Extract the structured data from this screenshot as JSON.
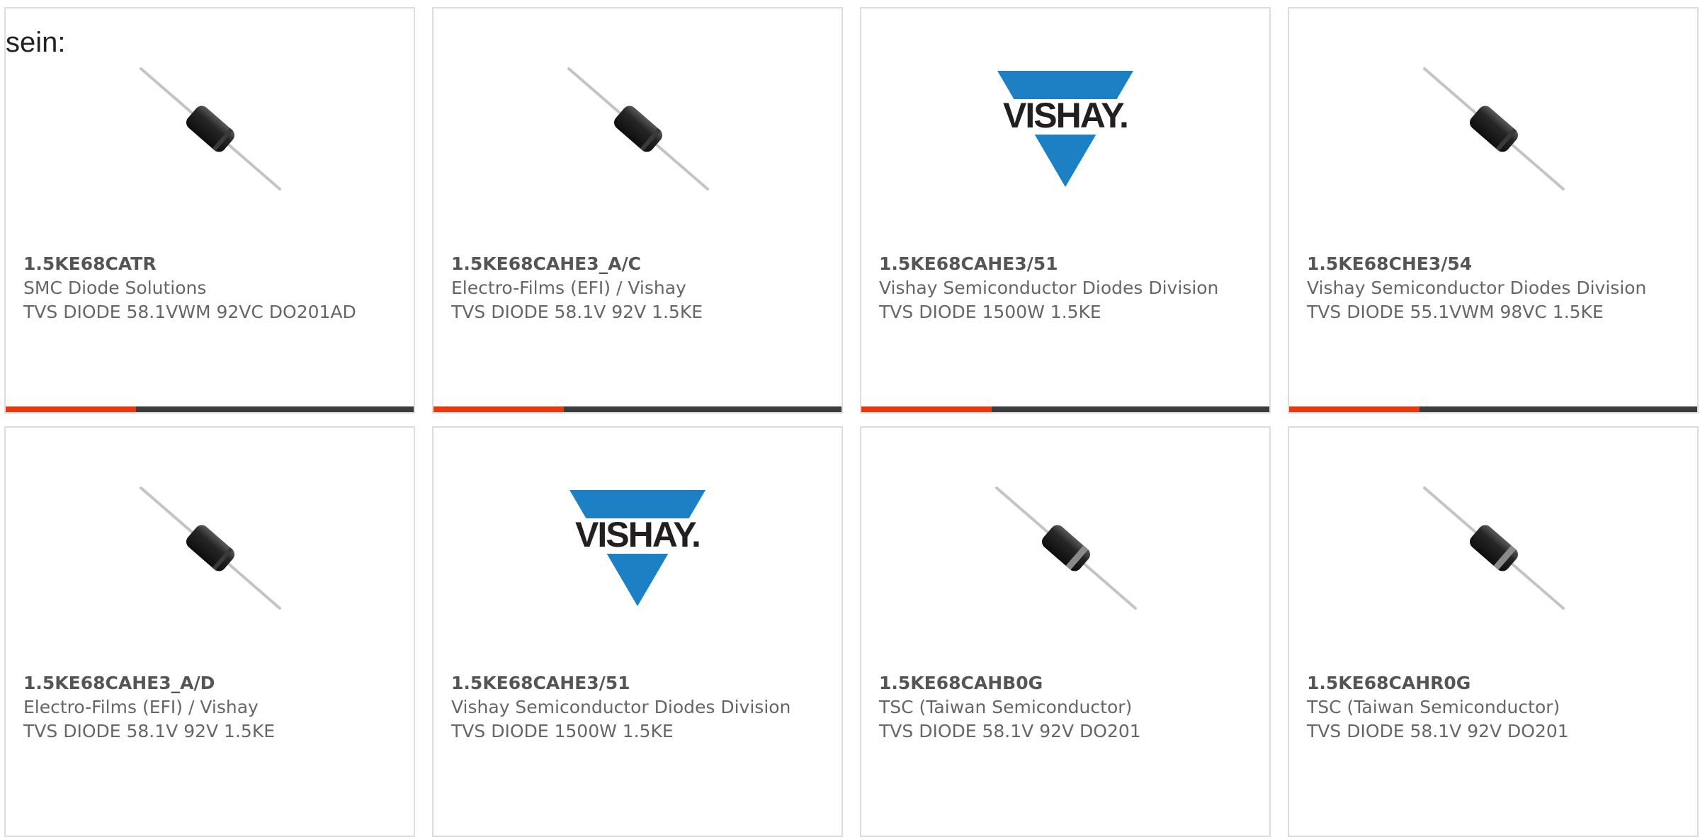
{
  "intro_text": "sein:",
  "accent_color": "#e8380d",
  "bar_color": "#3c3c3c",
  "products": [
    {
      "part": "1.5KE68CATR",
      "manufacturer": "SMC Diode Solutions",
      "description": "TVS DIODE 58.1VWM 92VC DO201AD",
      "image": "diode-axial",
      "progress_fraction": 0.32
    },
    {
      "part": "1.5KE68CAHE3_A/C",
      "manufacturer": "Electro-Films (EFI) / Vishay",
      "description": "TVS DIODE 58.1V 92V 1.5KE",
      "image": "diode-axial",
      "progress_fraction": 0.32
    },
    {
      "part": "1.5KE68CAHE3/51",
      "manufacturer": "Vishay Semiconductor Diodes Division",
      "description": "TVS DIODE 1500W 1.5KE",
      "image": "vishay-logo",
      "logo_text": "VISHAY.",
      "progress_fraction": 0.32
    },
    {
      "part": "1.5KE68CHE3/54",
      "manufacturer": "Vishay Semiconductor Diodes Division",
      "description": "TVS DIODE 55.1VWM 98VC 1.5KE",
      "image": "diode-axial",
      "progress_fraction": 0.32
    },
    {
      "part": "1.5KE68CAHE3_A/D",
      "manufacturer": "Electro-Films (EFI) / Vishay",
      "description": "TVS DIODE 58.1V 92V 1.5KE",
      "image": "diode-axial"
    },
    {
      "part": "1.5KE68CAHE3/51",
      "manufacturer": "Vishay Semiconductor Diodes Division",
      "description": "TVS DIODE 1500W 1.5KE",
      "image": "vishay-logo",
      "logo_text": "VISHAY."
    },
    {
      "part": "1.5KE68CAHB0G",
      "manufacturer": "TSC (Taiwan Semiconductor)",
      "description": "TVS DIODE 58.1V 92V DO201",
      "image": "diode-axial-banded"
    },
    {
      "part": "1.5KE68CAHR0G",
      "manufacturer": "TSC (Taiwan Semiconductor)",
      "description": "TVS DIODE 58.1V 92V DO201",
      "image": "diode-axial-banded"
    }
  ]
}
